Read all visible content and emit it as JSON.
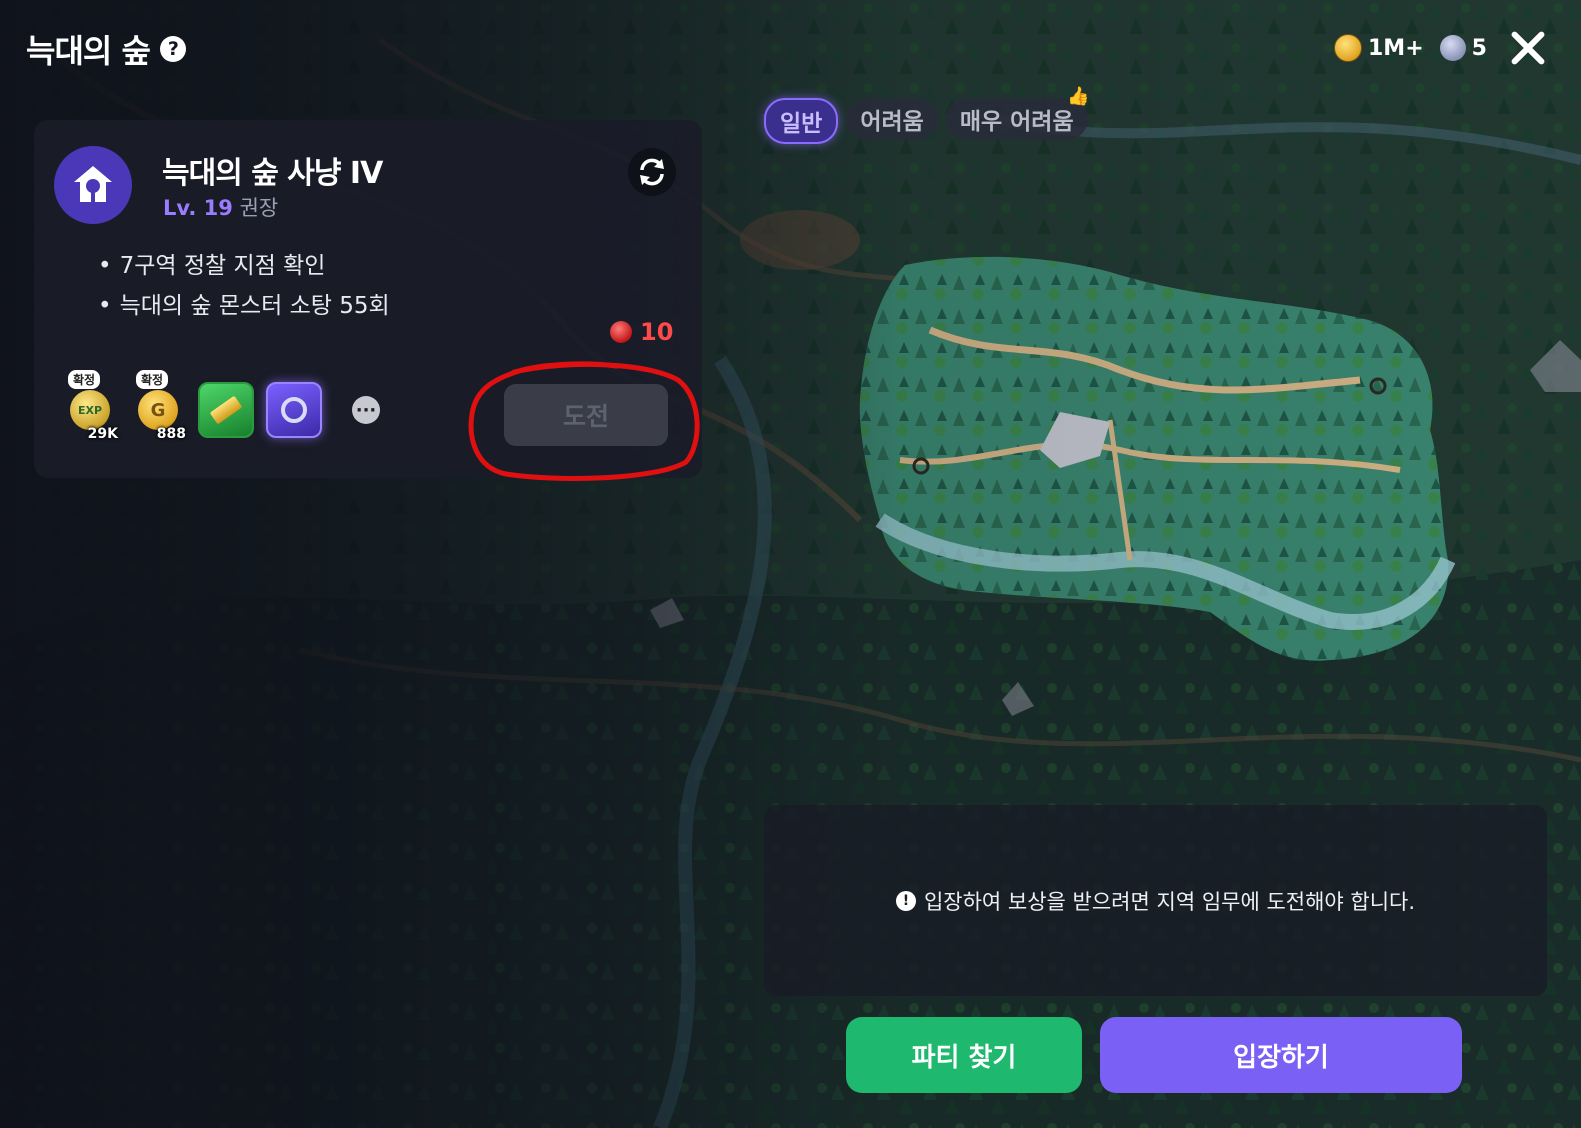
{
  "header": {
    "title": "늑대의 숲",
    "help_icon": "question-icon",
    "gold_amount": "1M+",
    "gem_amount": "5",
    "close_icon": "close-icon"
  },
  "difficulty_tabs": [
    {
      "label": "일반",
      "active": true
    },
    {
      "label": "어려움",
      "active": false
    },
    {
      "label": "매우 어려움",
      "active": false
    }
  ],
  "quest": {
    "name": "늑대의 숲 사냥 IV",
    "level_prefix": "Lv. 19",
    "level_suffix": "권장",
    "objectives": [
      "7구역 정찰 지점 확인",
      "늑대의 숲 몬스터 소탕 55회"
    ],
    "cost": "10",
    "challenge_label": "도전"
  },
  "rewards": [
    {
      "badge": "확정",
      "count": "29K",
      "icon": "exp-icon",
      "label": "EXP"
    },
    {
      "badge": "확정",
      "count": "888",
      "icon": "gold-coin-icon",
      "label": "G"
    },
    {
      "icon": "gold-bar-icon"
    },
    {
      "icon": "ring-icon"
    }
  ],
  "notice": "입장하여 보상을 받으려면 지역 임무에 도전해야 합니다.",
  "buttons": {
    "party": "파티 찾기",
    "enter": "입장하기"
  },
  "colors": {
    "accent": "#7b60f5",
    "party_green": "#1fb86f",
    "cost_red": "#ff4a4a",
    "annotation_red": "#e01010"
  }
}
